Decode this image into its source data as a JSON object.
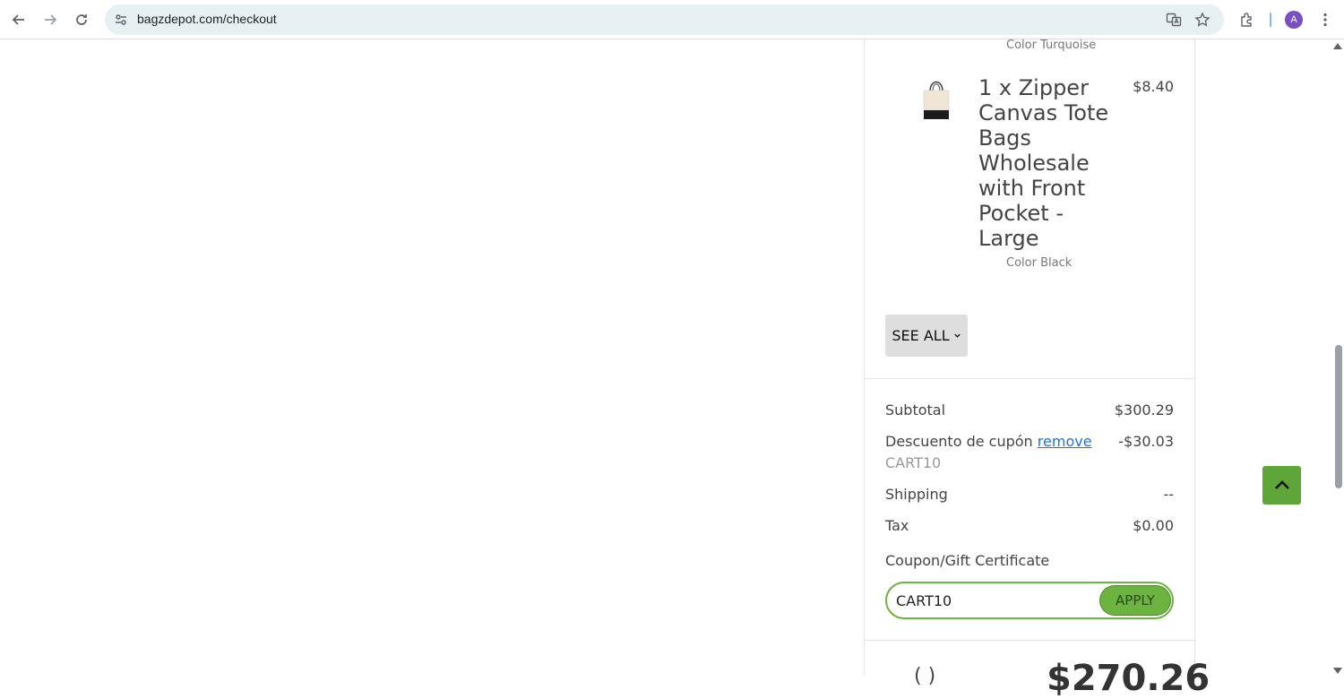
{
  "browser": {
    "url": "bagzdepot.com/checkout",
    "profile_initial": "A"
  },
  "order_summary": {
    "previous_item_color": "Color Turquoise",
    "item": {
      "name": "1 x Zipper Canvas Tote Bags Wholesale with Front Pocket - Large",
      "price": "$8.40",
      "color": "Color Black"
    },
    "see_all_label": "SEE ALL",
    "subtotal_label": "Subtotal",
    "subtotal_value": "$300.29",
    "discount_label": "Descuento de cupón",
    "remove_label": "remove",
    "discount_value": "-$30.03",
    "coupon_applied": "CART10",
    "shipping_label": "Shipping",
    "shipping_value": "--",
    "tax_label": "Tax",
    "tax_value": "$0.00",
    "coupon_section_label": "Coupon/Gift Certificate",
    "coupon_input_value": "CART10",
    "apply_label": "APPLY",
    "total_label_partial": "    (   )",
    "total_value_partial": "$270.26"
  },
  "colors": {
    "accent_green": "#6db33f",
    "to_top_green": "#5ea53a",
    "link_blue": "#1a73e8"
  }
}
